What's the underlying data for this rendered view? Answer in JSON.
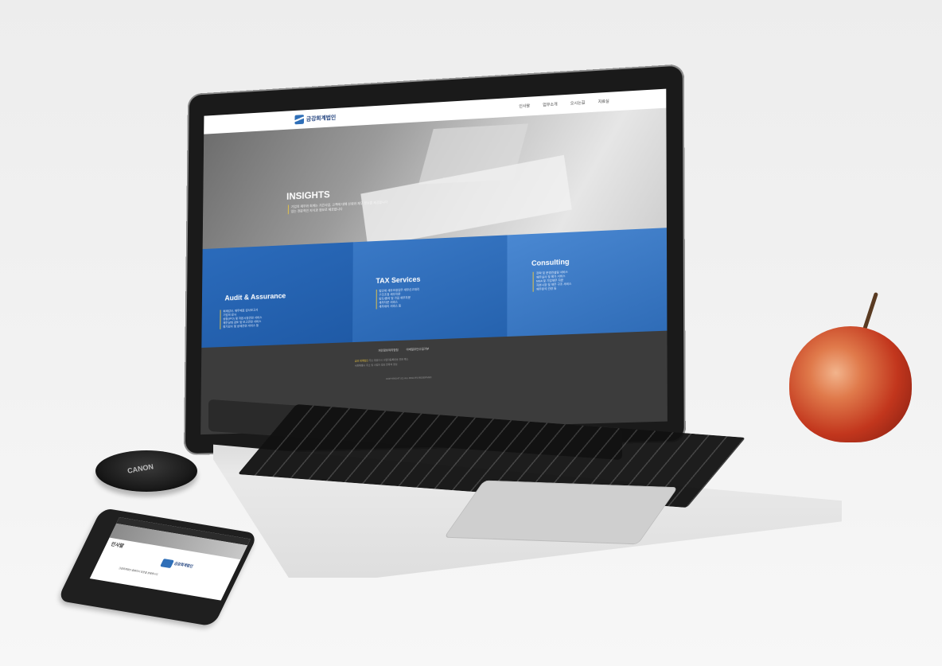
{
  "site": {
    "brand_name": "금강회계법인",
    "nav_items": [
      "인사말",
      "업무소개",
      "오시는길",
      "자료실"
    ],
    "hero": {
      "title": "INSIGHTS",
      "text_lines": [
        "기업의 재무와 회계는 기간사업, 고객에 대해 신뢰와 재무 정보를 제공합니다",
        "있는 전문적인 지식과 정보로 제공합니다"
      ]
    },
    "services": [
      {
        "title": "Audit & Assurance",
        "lines": [
          "회계감사, 재무제표 감사보고서",
          "기업의 감사",
          "상장(IPO) 및 자본시장관련 서비스",
          "재무상태 검토 및 보고관련 서비스",
          "정기감사 및 상세관련 서비스 등"
        ]
      },
      {
        "title": "TAX Services",
        "lines": [
          "법인세 세무조정업무 세무신고대리",
          "구조조정 세무자문",
          "양도/증여 및 가업 세무자문",
          "세무자문 서비스",
          "세무대리 서비스 등"
        ]
      },
      {
        "title": "Consulting",
        "lines": [
          "전략 및 운영컨설팅 서비스",
          "재무실사 및 평가 서비스",
          "M&A 및 기업재무 자문",
          "자본시장 및 재무 구조 서비스",
          "재무분석 관련 등"
        ]
      }
    ],
    "footer": {
      "links": [
        "개인정보처리방침",
        "이메일무단수집거부"
      ],
      "line1_highlight": "금강 회계법인",
      "line1_text": "주소 대표이사 사업자등록번호 전화 팩스",
      "line2_text": "서울특별시 주소 및 사업자 정보 연락처 정보",
      "copyright": "COPYRIGHT (C) ALL RIGHTS RESERVED"
    }
  },
  "lens_cap_text": "CANON",
  "phone": {
    "title": "인사말",
    "brand_name": "금강회계법인",
    "text": "금강회계법인 홈페이지 방문을 환영합니다"
  }
}
